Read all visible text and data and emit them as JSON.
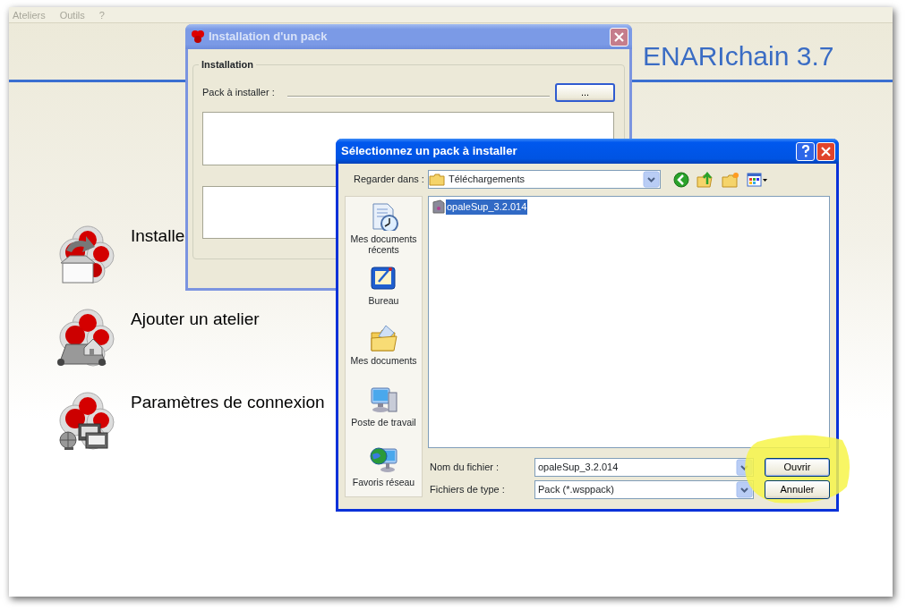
{
  "app": {
    "menu": [
      {
        "label": "Ateliers",
        "disabled": true
      },
      {
        "label": "Outils",
        "disabled": true
      },
      {
        "label": "?",
        "disabled": true
      }
    ],
    "title": "ENARIchain 3.7",
    "actions": [
      {
        "label": "Installe",
        "kind": "install"
      },
      {
        "label": "Ajouter un atelier",
        "kind": "workshop"
      },
      {
        "label": "Paramètres de connexion",
        "kind": "network"
      }
    ]
  },
  "install_dialog": {
    "title": "Installation d'un pack",
    "active": false,
    "group": "Installation",
    "field_label": "Pack à installer :",
    "browse_button": "..."
  },
  "file_dialog": {
    "title": "Sélectionnez un pack à installer",
    "active": true,
    "look_in_label": "Regarder dans :",
    "look_in": "Téléchargements",
    "places": [
      {
        "label": "Mes documents récents",
        "kind": "recent"
      },
      {
        "label": "Bureau",
        "kind": "desktop"
      },
      {
        "label": "Mes documents",
        "kind": "documents"
      },
      {
        "label": "Poste de travail",
        "kind": "computer"
      },
      {
        "label": "Favoris réseau",
        "kind": "network"
      }
    ],
    "files": [
      {
        "name": "opaleSup_3.2.014",
        "selected": true
      }
    ],
    "filename_label": "Nom du fichier :",
    "filename": "opaleSup_3.2.014",
    "filetype_label": "Fichiers de type :",
    "filetype": "Pack (*.wsppack)",
    "buttons": [
      {
        "label": "Ouvrir",
        "kind": "default"
      },
      {
        "label": "Annuler",
        "kind": "cancel"
      }
    ]
  }
}
